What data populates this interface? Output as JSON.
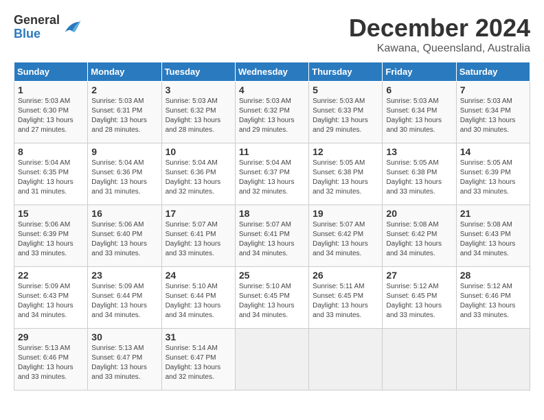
{
  "header": {
    "logo_general": "General",
    "logo_blue": "Blue",
    "main_title": "December 2024",
    "subtitle": "Kawana, Queensland, Australia"
  },
  "calendar": {
    "days_of_week": [
      "Sunday",
      "Monday",
      "Tuesday",
      "Wednesday",
      "Thursday",
      "Friday",
      "Saturday"
    ],
    "weeks": [
      [
        {
          "day": "",
          "info": ""
        },
        {
          "day": "2",
          "info": "Sunrise: 5:03 AM\nSunset: 6:31 PM\nDaylight: 13 hours\nand 28 minutes."
        },
        {
          "day": "3",
          "info": "Sunrise: 5:03 AM\nSunset: 6:32 PM\nDaylight: 13 hours\nand 28 minutes."
        },
        {
          "day": "4",
          "info": "Sunrise: 5:03 AM\nSunset: 6:32 PM\nDaylight: 13 hours\nand 29 minutes."
        },
        {
          "day": "5",
          "info": "Sunrise: 5:03 AM\nSunset: 6:33 PM\nDaylight: 13 hours\nand 29 minutes."
        },
        {
          "day": "6",
          "info": "Sunrise: 5:03 AM\nSunset: 6:34 PM\nDaylight: 13 hours\nand 30 minutes."
        },
        {
          "day": "7",
          "info": "Sunrise: 5:03 AM\nSunset: 6:34 PM\nDaylight: 13 hours\nand 30 minutes."
        }
      ],
      [
        {
          "day": "8",
          "info": "Sunrise: 5:04 AM\nSunset: 6:35 PM\nDaylight: 13 hours\nand 31 minutes."
        },
        {
          "day": "9",
          "info": "Sunrise: 5:04 AM\nSunset: 6:36 PM\nDaylight: 13 hours\nand 31 minutes."
        },
        {
          "day": "10",
          "info": "Sunrise: 5:04 AM\nSunset: 6:36 PM\nDaylight: 13 hours\nand 32 minutes."
        },
        {
          "day": "11",
          "info": "Sunrise: 5:04 AM\nSunset: 6:37 PM\nDaylight: 13 hours\nand 32 minutes."
        },
        {
          "day": "12",
          "info": "Sunrise: 5:05 AM\nSunset: 6:38 PM\nDaylight: 13 hours\nand 32 minutes."
        },
        {
          "day": "13",
          "info": "Sunrise: 5:05 AM\nSunset: 6:38 PM\nDaylight: 13 hours\nand 33 minutes."
        },
        {
          "day": "14",
          "info": "Sunrise: 5:05 AM\nSunset: 6:39 PM\nDaylight: 13 hours\nand 33 minutes."
        }
      ],
      [
        {
          "day": "15",
          "info": "Sunrise: 5:06 AM\nSunset: 6:39 PM\nDaylight: 13 hours\nand 33 minutes."
        },
        {
          "day": "16",
          "info": "Sunrise: 5:06 AM\nSunset: 6:40 PM\nDaylight: 13 hours\nand 33 minutes."
        },
        {
          "day": "17",
          "info": "Sunrise: 5:07 AM\nSunset: 6:41 PM\nDaylight: 13 hours\nand 33 minutes."
        },
        {
          "day": "18",
          "info": "Sunrise: 5:07 AM\nSunset: 6:41 PM\nDaylight: 13 hours\nand 34 minutes."
        },
        {
          "day": "19",
          "info": "Sunrise: 5:07 AM\nSunset: 6:42 PM\nDaylight: 13 hours\nand 34 minutes."
        },
        {
          "day": "20",
          "info": "Sunrise: 5:08 AM\nSunset: 6:42 PM\nDaylight: 13 hours\nand 34 minutes."
        },
        {
          "day": "21",
          "info": "Sunrise: 5:08 AM\nSunset: 6:43 PM\nDaylight: 13 hours\nand 34 minutes."
        }
      ],
      [
        {
          "day": "22",
          "info": "Sunrise: 5:09 AM\nSunset: 6:43 PM\nDaylight: 13 hours\nand 34 minutes."
        },
        {
          "day": "23",
          "info": "Sunrise: 5:09 AM\nSunset: 6:44 PM\nDaylight: 13 hours\nand 34 minutes."
        },
        {
          "day": "24",
          "info": "Sunrise: 5:10 AM\nSunset: 6:44 PM\nDaylight: 13 hours\nand 34 minutes."
        },
        {
          "day": "25",
          "info": "Sunrise: 5:10 AM\nSunset: 6:45 PM\nDaylight: 13 hours\nand 34 minutes."
        },
        {
          "day": "26",
          "info": "Sunrise: 5:11 AM\nSunset: 6:45 PM\nDaylight: 13 hours\nand 33 minutes."
        },
        {
          "day": "27",
          "info": "Sunrise: 5:12 AM\nSunset: 6:45 PM\nDaylight: 13 hours\nand 33 minutes."
        },
        {
          "day": "28",
          "info": "Sunrise: 5:12 AM\nSunset: 6:46 PM\nDaylight: 13 hours\nand 33 minutes."
        }
      ],
      [
        {
          "day": "29",
          "info": "Sunrise: 5:13 AM\nSunset: 6:46 PM\nDaylight: 13 hours\nand 33 minutes."
        },
        {
          "day": "30",
          "info": "Sunrise: 5:13 AM\nSunset: 6:47 PM\nDaylight: 13 hours\nand 33 minutes."
        },
        {
          "day": "31",
          "info": "Sunrise: 5:14 AM\nSunset: 6:47 PM\nDaylight: 13 hours\nand 32 minutes."
        },
        {
          "day": "",
          "info": ""
        },
        {
          "day": "",
          "info": ""
        },
        {
          "day": "",
          "info": ""
        },
        {
          "day": "",
          "info": ""
        }
      ]
    ],
    "week1_day1": {
      "day": "1",
      "info": "Sunrise: 5:03 AM\nSunset: 6:30 PM\nDaylight: 13 hours\nand 27 minutes."
    }
  }
}
